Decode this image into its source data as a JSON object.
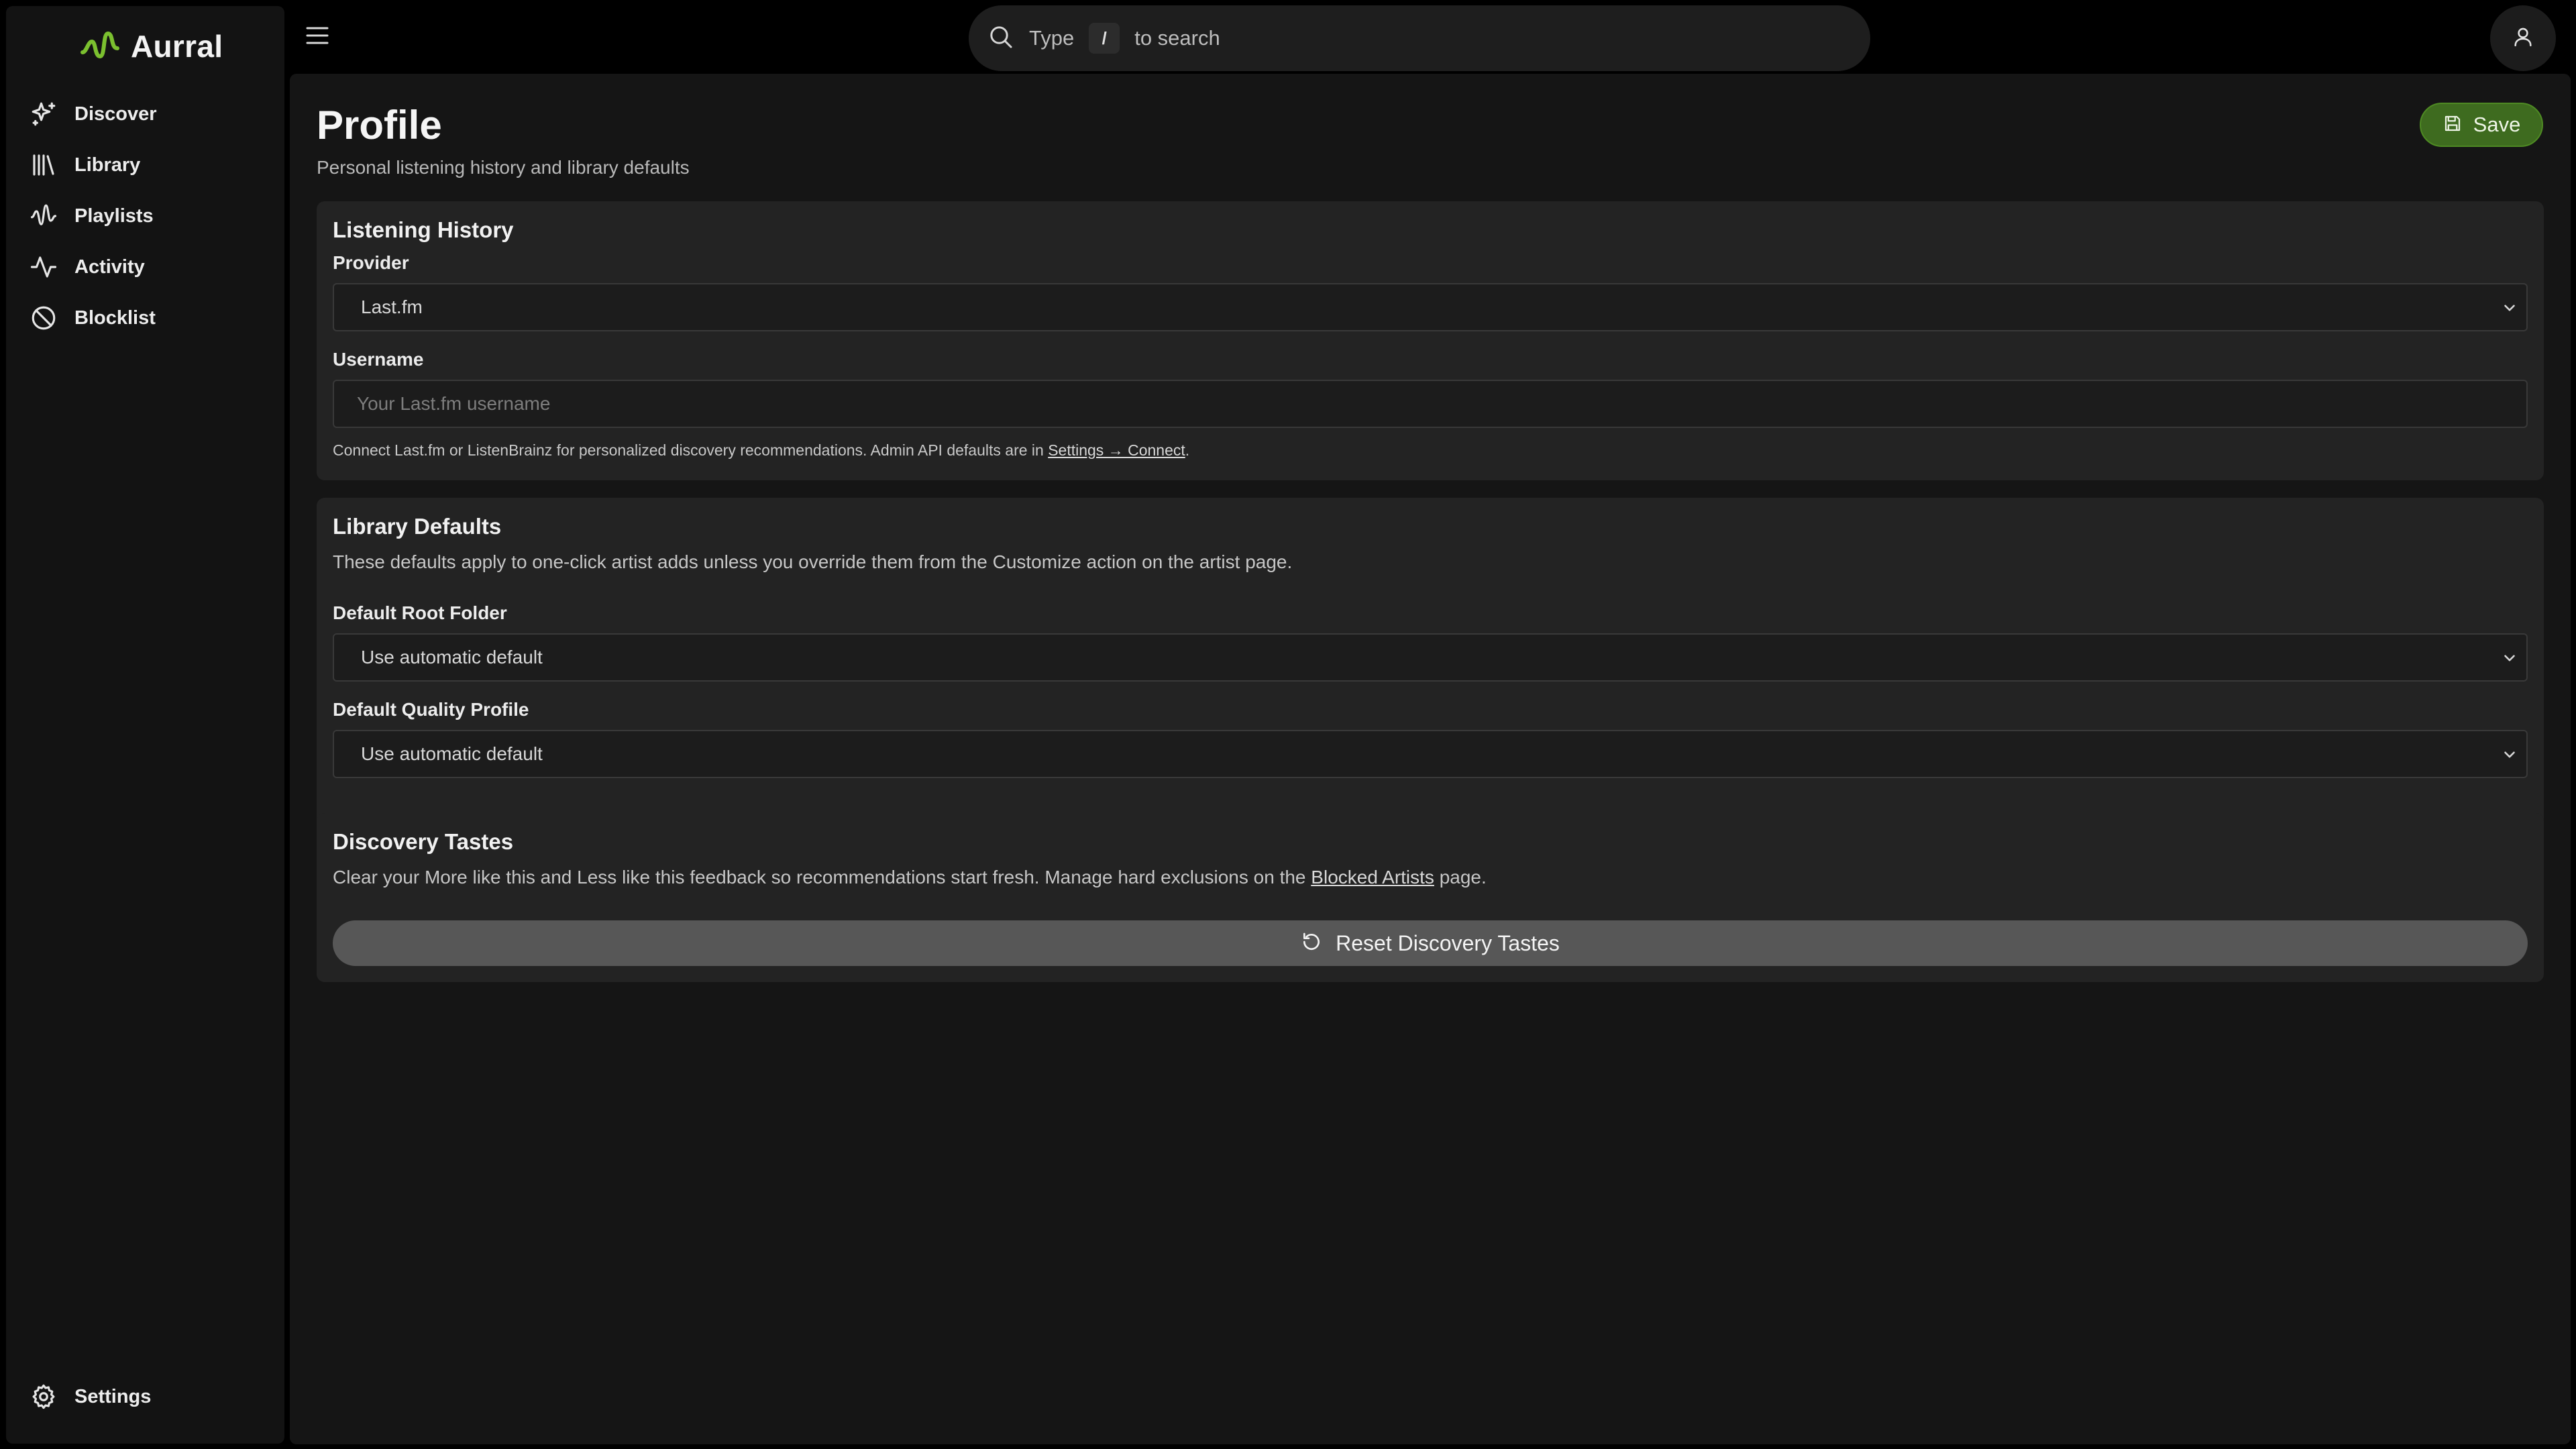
{
  "brand": {
    "name": "Aurral",
    "logo_icon": "waveform-logo-icon",
    "accent": "#7bc02f"
  },
  "sidebar": {
    "items": [
      {
        "label": "Discover",
        "icon": "sparkles-icon"
      },
      {
        "label": "Library",
        "icon": "library-icon"
      },
      {
        "label": "Playlists",
        "icon": "audio-waveform-icon"
      },
      {
        "label": "Activity",
        "icon": "activity-icon"
      },
      {
        "label": "Blocklist",
        "icon": "ban-icon"
      }
    ],
    "footer_item": {
      "label": "Settings",
      "icon": "gear-icon"
    }
  },
  "header": {
    "search_prefix": "Type",
    "search_key": "/",
    "search_suffix": "to search"
  },
  "page": {
    "title": "Profile",
    "subtitle": "Personal listening history and library defaults",
    "save_label": "Save"
  },
  "listening_history": {
    "heading": "Listening History",
    "provider_label": "Provider",
    "provider_value": "Last.fm",
    "username_label": "Username",
    "username_placeholder": "Your Last.fm username",
    "username_value": "",
    "help_prefix": "Connect Last.fm or ListenBrainz for personalized discovery recommendations. Admin API defaults are in ",
    "help_link": "Settings → Connect",
    "help_suffix": "."
  },
  "library_defaults": {
    "heading": "Library Defaults",
    "description": "These defaults apply to one-click artist adds unless you override them from the Customize action on the artist page.",
    "root_folder_label": "Default Root Folder",
    "root_folder_value": "Use automatic default",
    "quality_label": "Default Quality Profile",
    "quality_value": "Use automatic default"
  },
  "discovery_tastes": {
    "heading": "Discovery Tastes",
    "desc_prefix": "Clear your More like this and Less like this feedback so recommendations start fresh. Manage hard exclusions on the ",
    "desc_link": "Blocked Artists",
    "desc_suffix": " page.",
    "reset_label": "Reset Discovery Tastes"
  },
  "colors": {
    "background": "#000000",
    "panel": "#151515",
    "card": "#232323",
    "save_button": "#3e6b1f",
    "reset_button": "#575757"
  }
}
